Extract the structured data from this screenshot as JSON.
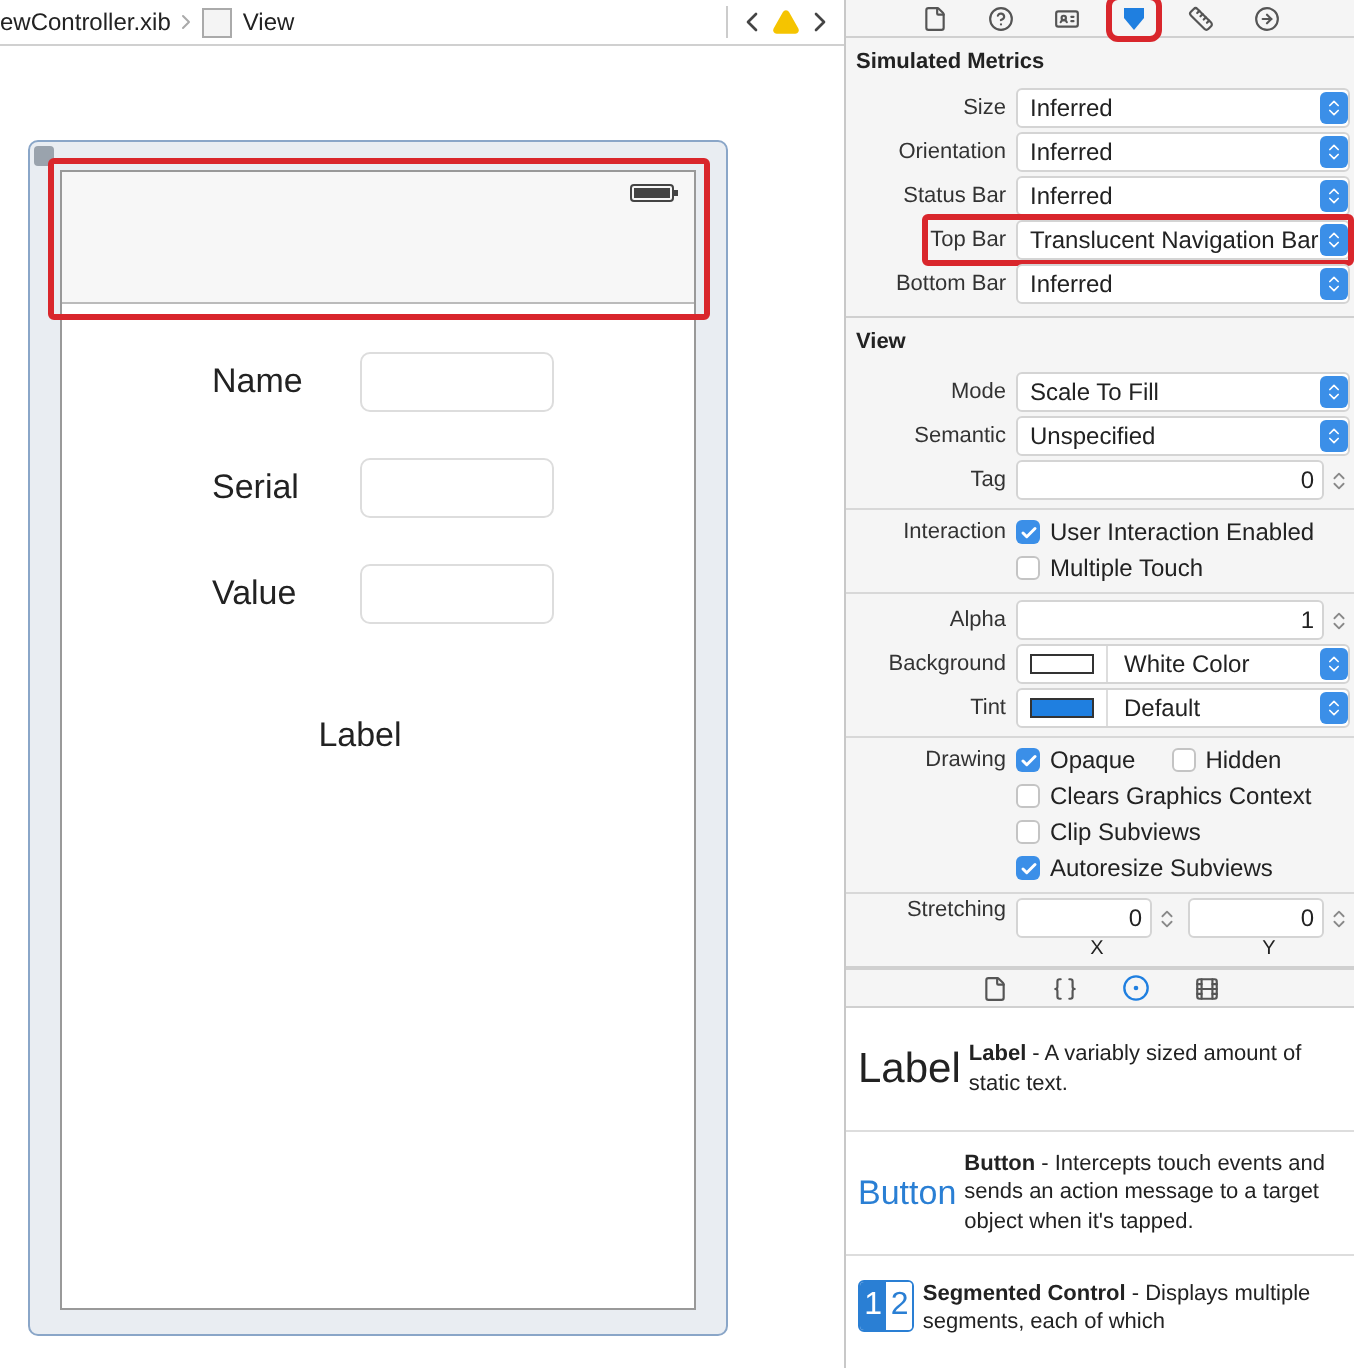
{
  "breadcrumb": {
    "items": [
      "ewController.xib",
      "View"
    ],
    "warning": true
  },
  "inspector_tabs": [
    {
      "kind": "file",
      "selected": false
    },
    {
      "kind": "help",
      "selected": false
    },
    {
      "kind": "identity",
      "selected": false
    },
    {
      "kind": "attributes",
      "selected": true,
      "highlighted": true
    },
    {
      "kind": "size",
      "selected": false
    },
    {
      "kind": "connections",
      "selected": false
    }
  ],
  "simulated_metrics": {
    "title": "Simulated Metrics",
    "rows": [
      {
        "label": "Size",
        "value": "Inferred",
        "highlighted": false
      },
      {
        "label": "Orientation",
        "value": "Inferred",
        "highlighted": false
      },
      {
        "label": "Status Bar",
        "value": "Inferred",
        "highlighted": false
      },
      {
        "label": "Top Bar",
        "value": "Translucent Navigation Bar",
        "highlighted": true
      },
      {
        "label": "Bottom Bar",
        "value": "Inferred",
        "highlighted": false
      }
    ]
  },
  "view_section": {
    "title": "View",
    "groups": [
      [
        {
          "kind": "popup",
          "label": "Mode",
          "value": "Scale To Fill"
        },
        {
          "kind": "popup",
          "label": "Semantic",
          "value": "Unspecified"
        },
        {
          "kind": "number",
          "label": "Tag",
          "value": "0"
        }
      ],
      [
        {
          "kind": "checks",
          "label": "Interaction",
          "items": [
            {
              "text": "User Interaction Enabled",
              "checked": true
            }
          ]
        },
        {
          "kind": "checks",
          "items": [
            {
              "text": "Multiple Touch",
              "checked": false
            }
          ]
        }
      ],
      [
        {
          "kind": "number",
          "label": "Alpha",
          "value": "1"
        },
        {
          "kind": "color",
          "label": "Background",
          "value": "White Color",
          "color": "#ffffff"
        },
        {
          "kind": "color",
          "label": "Tint",
          "value": "Default",
          "color": "#1f7fe0"
        }
      ],
      [
        {
          "kind": "checks",
          "label": "Drawing",
          "items": [
            {
              "text": "Opaque",
              "checked": true
            },
            {
              "text": "Hidden",
              "checked": false
            }
          ]
        },
        {
          "kind": "checks",
          "items": [
            {
              "text": "Clears Graphics Context",
              "checked": false
            }
          ]
        },
        {
          "kind": "checks",
          "items": [
            {
              "text": "Clip Subviews",
              "checked": false
            }
          ]
        },
        {
          "kind": "checks",
          "items": [
            {
              "text": "Autoresize Subviews",
              "checked": true
            }
          ]
        }
      ],
      [
        {
          "kind": "pair",
          "label": "Stretching",
          "fields": [
            {
              "value": "0",
              "caption": "X"
            },
            {
              "value": "0",
              "caption": "Y"
            }
          ]
        }
      ]
    ]
  },
  "library_tabs": [
    {
      "kind": "file",
      "selected": false
    },
    {
      "kind": "code",
      "selected": false
    },
    {
      "kind": "objects",
      "selected": true
    },
    {
      "kind": "media",
      "selected": false
    }
  ],
  "library_items": [
    {
      "kind": "label",
      "preview": "Label",
      "description": "**Label** - A variably sized amount of static text."
    },
    {
      "kind": "button",
      "preview": "Button",
      "description": "**Button** - Intercepts touch events and sends an action message to a target object when it's tapped."
    },
    {
      "kind": "segmented",
      "segments": [
        {
          "text": "1",
          "selected": true
        },
        {
          "text": "2",
          "selected": false
        }
      ],
      "description": "**Segmented Control** - Displays multiple segments, each of which"
    }
  ],
  "canvas": {
    "nav_bar_highlighted": true,
    "form": [
      {
        "label": "Name"
      },
      {
        "label": "Serial"
      },
      {
        "label": "Value"
      }
    ],
    "label": "Label"
  }
}
